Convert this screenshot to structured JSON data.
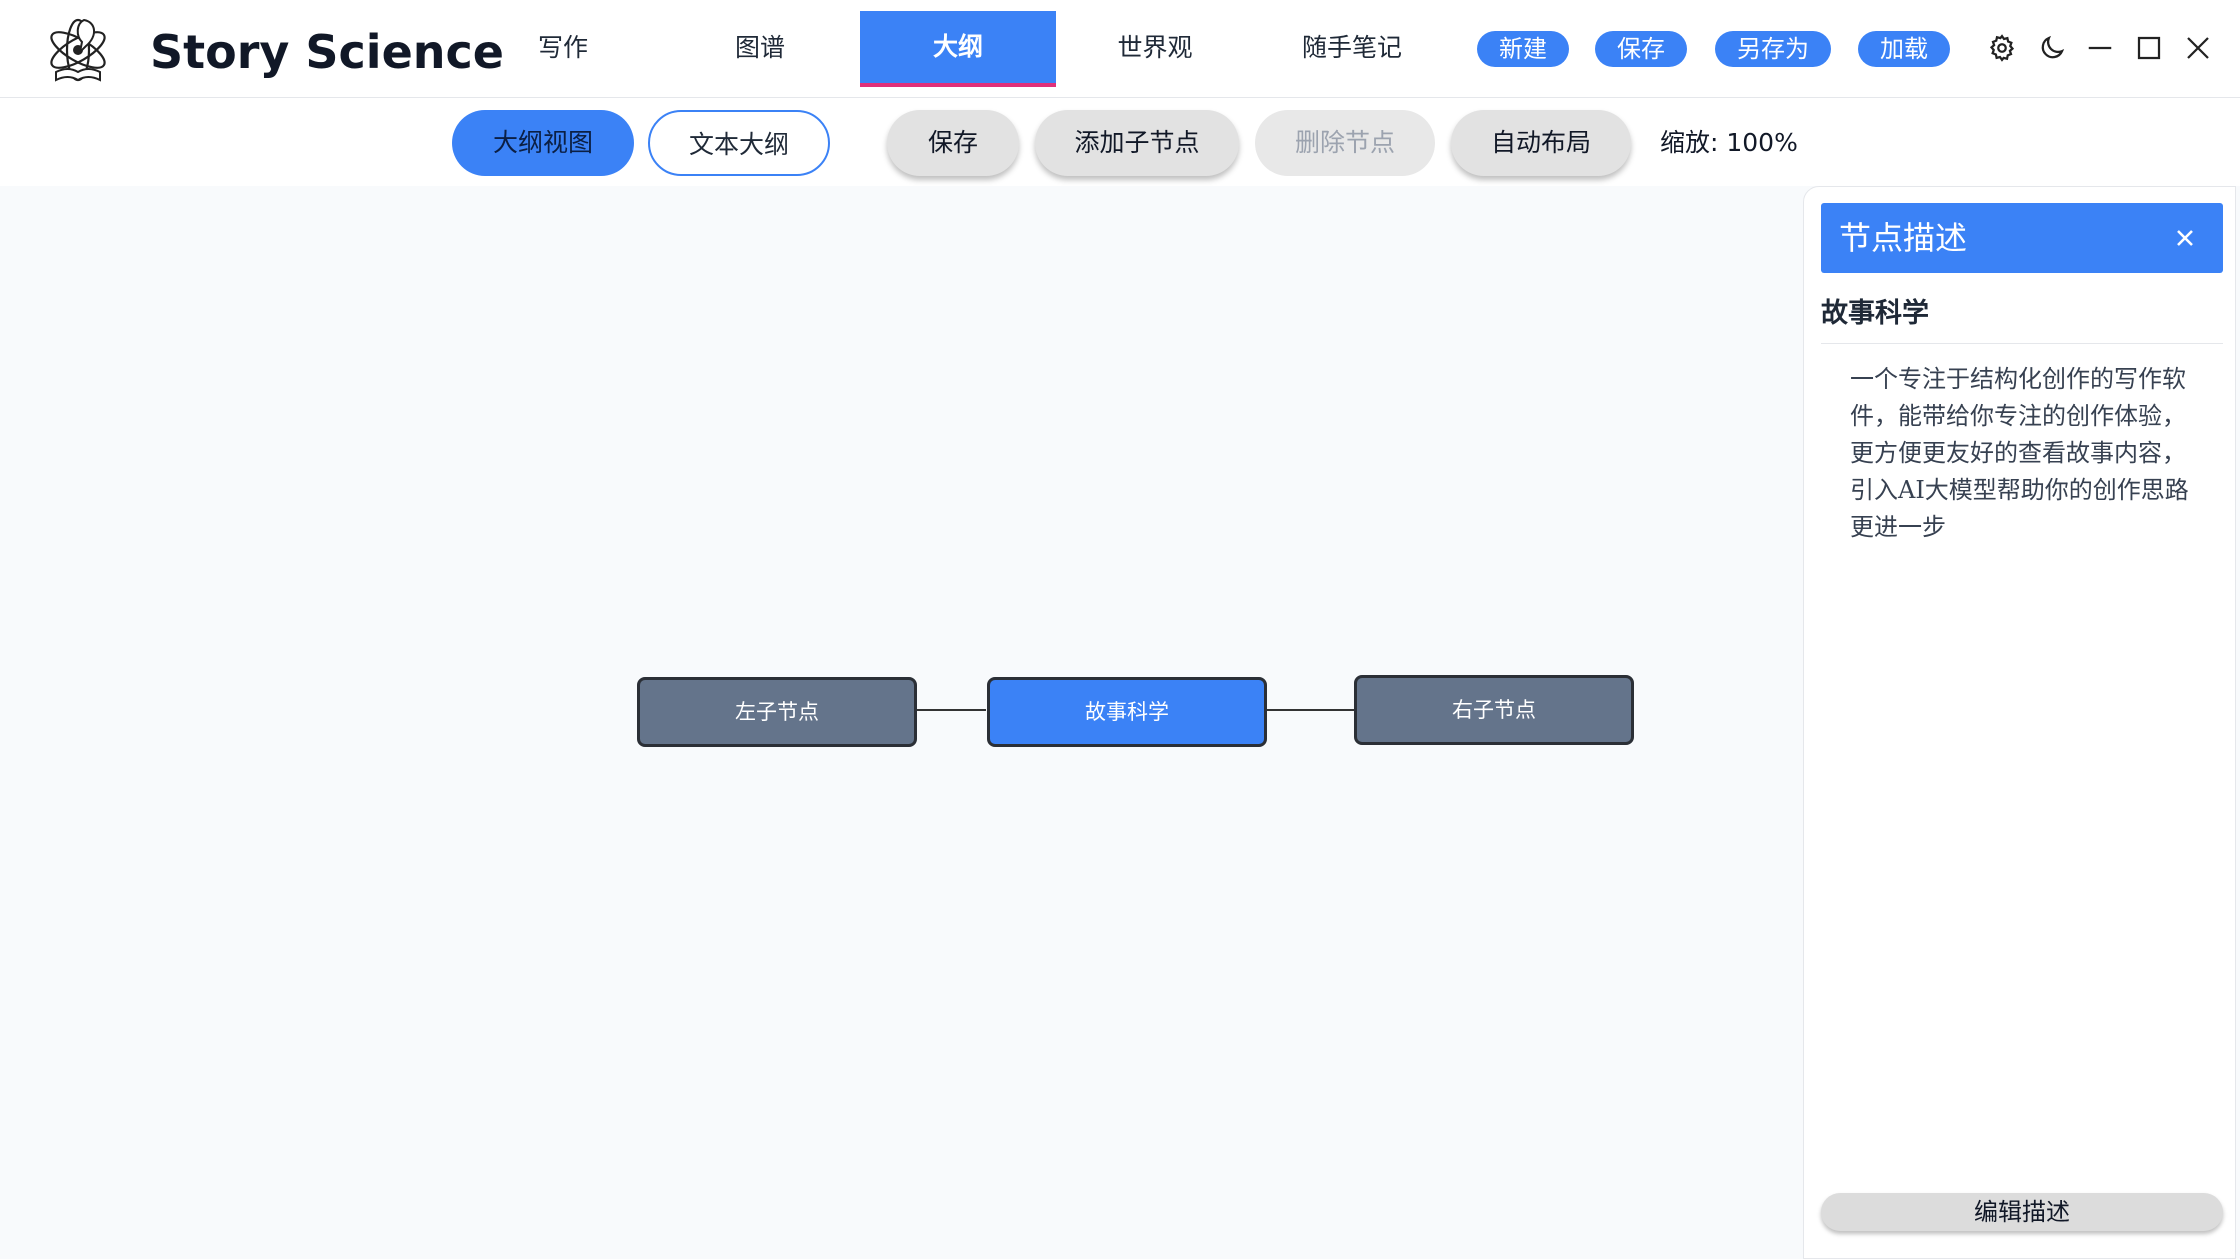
{
  "app": {
    "title": "Story Science",
    "logo_icon": "atom-quill-book-icon"
  },
  "nav": {
    "tabs": [
      {
        "label": "写作",
        "active": false
      },
      {
        "label": "图谱",
        "active": false
      },
      {
        "label": "大纲",
        "active": true
      },
      {
        "label": "世界观",
        "active": false
      },
      {
        "label": "随手笔记",
        "active": false
      }
    ]
  },
  "file_actions": {
    "new": "新建",
    "save": "保存",
    "save_as": "另存为",
    "load": "加载"
  },
  "window_controls": {
    "settings_icon": "gear-icon",
    "theme_icon": "moon-icon",
    "minimize_icon": "minimize-icon",
    "maximize_icon": "maximize-icon",
    "close_icon": "close-icon"
  },
  "toolbar": {
    "outline_view": "大纲视图",
    "text_outline": "文本大纲",
    "save": "保存",
    "add_child": "添加子节点",
    "delete_node": "删除节点",
    "auto_layout": "自动布局",
    "zoom": "缩放: 100%"
  },
  "outline": {
    "nodes": {
      "left": "左子节点",
      "root": "故事科学",
      "right": "右子节点"
    }
  },
  "panel": {
    "header_title": "节点描述",
    "node_title": "故事科学",
    "description": "一个专注于结构化创作的写作软件，能带给你专注的创作体验，更方便更友好的查看故事内容，引入AI大模型帮助你的创作思路更进一步",
    "edit_button": "编辑描述"
  },
  "colors": {
    "accent": "#3b82f6",
    "active_underline": "#e0307a",
    "child_node": "#64748b",
    "canvas_bg": "#f8fafc"
  }
}
